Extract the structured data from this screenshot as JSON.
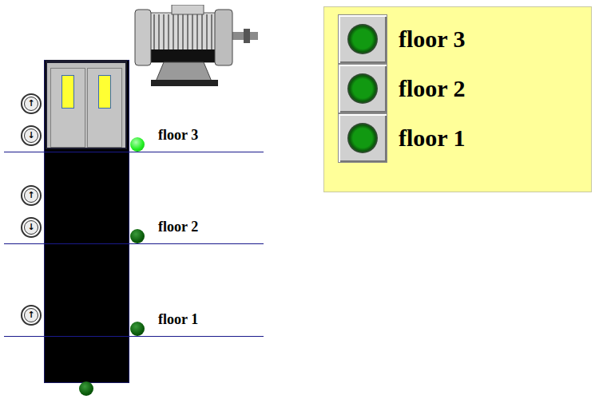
{
  "floors": [
    {
      "label": "floor 3",
      "sensor_on": true,
      "car_here": true,
      "calls": [
        {
          "arrow": "↑"
        },
        {
          "arrow": "↓"
        }
      ]
    },
    {
      "label": "floor 2",
      "sensor_on": false,
      "car_here": false,
      "calls": [
        {
          "arrow": "↑"
        },
        {
          "arrow": "↓"
        }
      ]
    },
    {
      "label": "floor 1",
      "sensor_on": false,
      "car_here": false,
      "calls": [
        {
          "arrow": "↑"
        }
      ]
    }
  ],
  "pit_sensor": {
    "on": false
  },
  "panel": {
    "buttons": [
      {
        "label": "floor 3"
      },
      {
        "label": "floor 2"
      },
      {
        "label": "floor 1"
      }
    ]
  }
}
